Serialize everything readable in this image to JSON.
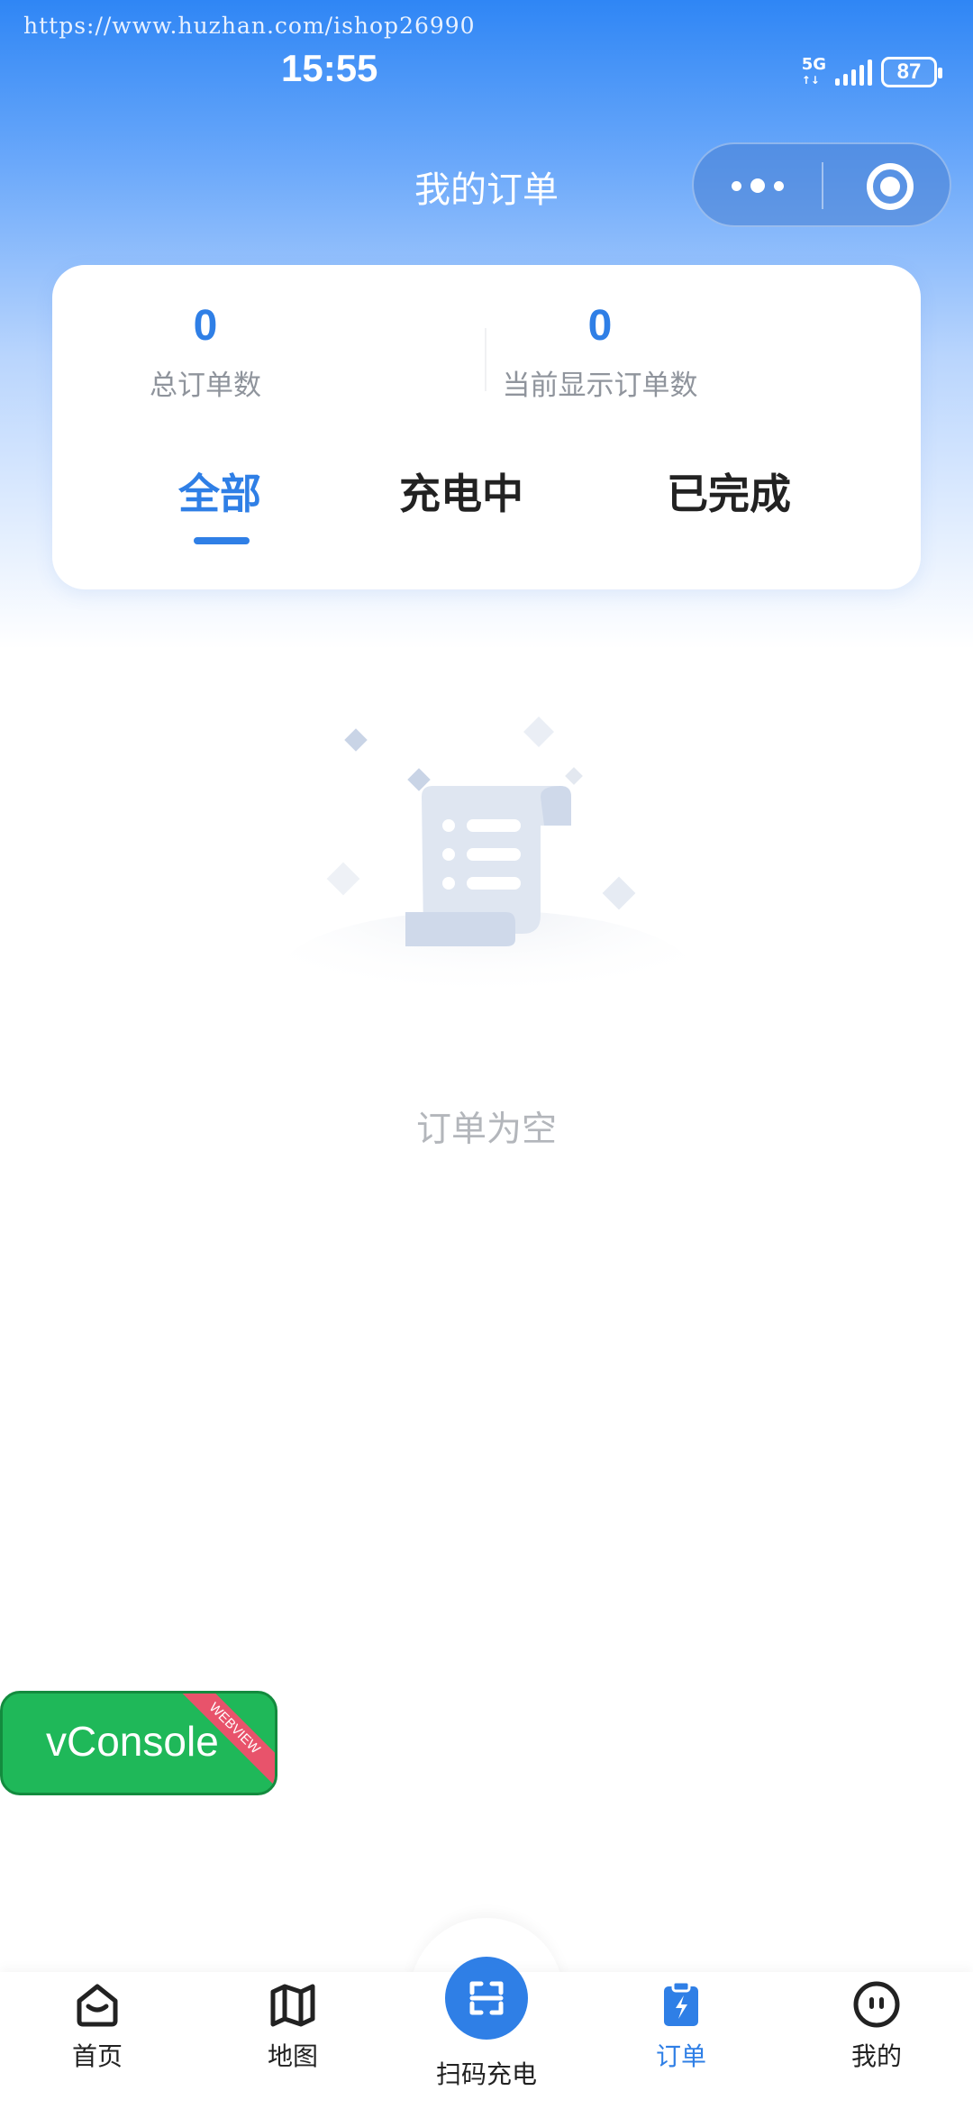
{
  "watermark": "https://www.huzhan.com/ishop26990",
  "status_bar": {
    "time": "15:55",
    "network": "5G",
    "battery": "87"
  },
  "nav": {
    "title": "我的订单",
    "more_icon": "more-dots-icon",
    "close_icon": "target-circle-icon"
  },
  "summary": {
    "total_orders": {
      "value": "0",
      "label": "总订单数"
    },
    "shown_orders": {
      "value": "0",
      "label": "当前显示订单数"
    }
  },
  "tabs": [
    {
      "label": "全部",
      "active": true
    },
    {
      "label": "充电中",
      "active": false
    },
    {
      "label": "已完成",
      "active": false
    }
  ],
  "empty_state": {
    "icon": "empty-document-illustration",
    "text": "订单为空"
  },
  "vconsole": {
    "label": "vConsole",
    "ribbon": "WEBVIEW"
  },
  "tabbar": {
    "items": [
      {
        "label": "首页",
        "icon": "home-icon",
        "active": false
      },
      {
        "label": "地图",
        "icon": "map-icon",
        "active": false
      },
      {
        "label": "扫码充电",
        "icon": "scan-icon",
        "active": false
      },
      {
        "label": "订单",
        "icon": "order-clipboard-icon",
        "active": true
      },
      {
        "label": "我的",
        "icon": "profile-face-icon",
        "active": false
      }
    ]
  },
  "colors": {
    "accent": "#2f7fe6",
    "header_top": "#2f86f5",
    "vconsole_green": "#1fb859",
    "ribbon_red": "#e8536b"
  }
}
